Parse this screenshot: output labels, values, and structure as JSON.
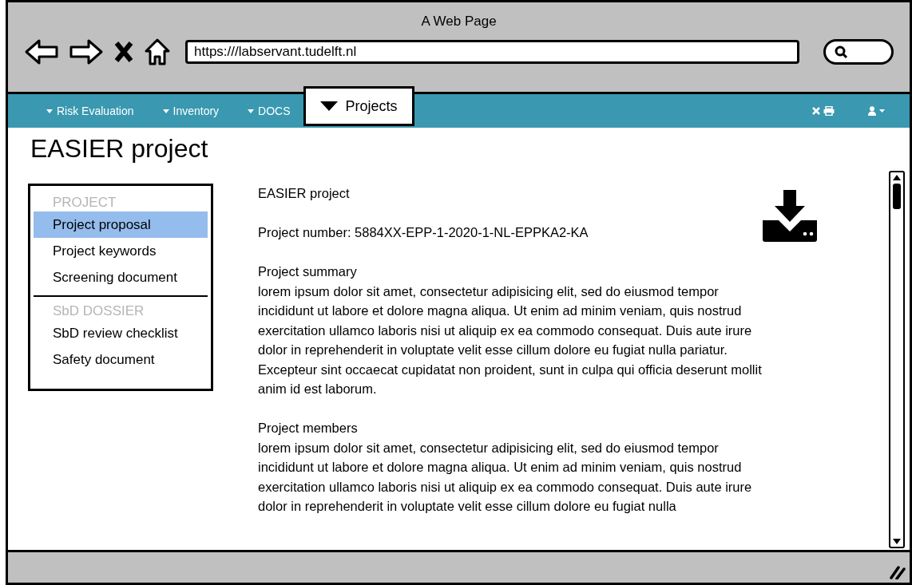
{
  "window": {
    "title": "A Web Page",
    "url": "https:///labservant.tudelft.nl"
  },
  "nav": {
    "items": [
      {
        "label": "Risk Evaluation",
        "selected": false
      },
      {
        "label": "Inventory",
        "selected": false
      },
      {
        "label": "DOCS",
        "selected": false
      },
      {
        "label": "Projects",
        "selected": true
      }
    ]
  },
  "page_title": "EASIER project",
  "sidebar": {
    "sections": [
      {
        "header": "PROJECT",
        "items": [
          {
            "label": "Project proposal",
            "selected": true
          },
          {
            "label": "Project keywords",
            "selected": false
          },
          {
            "label": "Screening document",
            "selected": false
          }
        ]
      },
      {
        "header": "SbD DOSSIER",
        "items": [
          {
            "label": "SbD review checklist",
            "selected": false
          },
          {
            "label": "Safety document",
            "selected": false
          }
        ]
      }
    ]
  },
  "content": {
    "blocks": [
      {
        "heading": "EASIER project"
      },
      {
        "heading": "Project number: 5884XX-EPP-1-2020-1-NL-EPPKA2-KA"
      },
      {
        "heading": "Project summary",
        "text": "lorem ipsum dolor sit amet, consectetur adipisicing elit, sed do eiusmod tempor incididunt ut labore et dolore magna aliqua. Ut enim ad minim veniam, quis nostrud exercitation ullamco laboris nisi ut aliquip ex ea commodo consequat. Duis aute irure dolor in reprehenderit in voluptate velit esse cillum dolore eu fugiat nulla pariatur. Excepteur sint occaecat cupidatat non proident, sunt in culpa qui officia deserunt mollit anim id est laborum."
      },
      {
        "heading": "Project members",
        "text": "lorem ipsum dolor sit amet, consectetur adipisicing elit, sed do eiusmod tempor incididunt ut labore et dolore magna aliqua. Ut enim ad minim veniam, quis nostrud exercitation ullamco laboris nisi ut aliquip ex ea commodo consequat. Duis aute irure dolor in reprehenderit in voluptate velit esse cillum dolore eu fugiat nulla"
      }
    ]
  }
}
